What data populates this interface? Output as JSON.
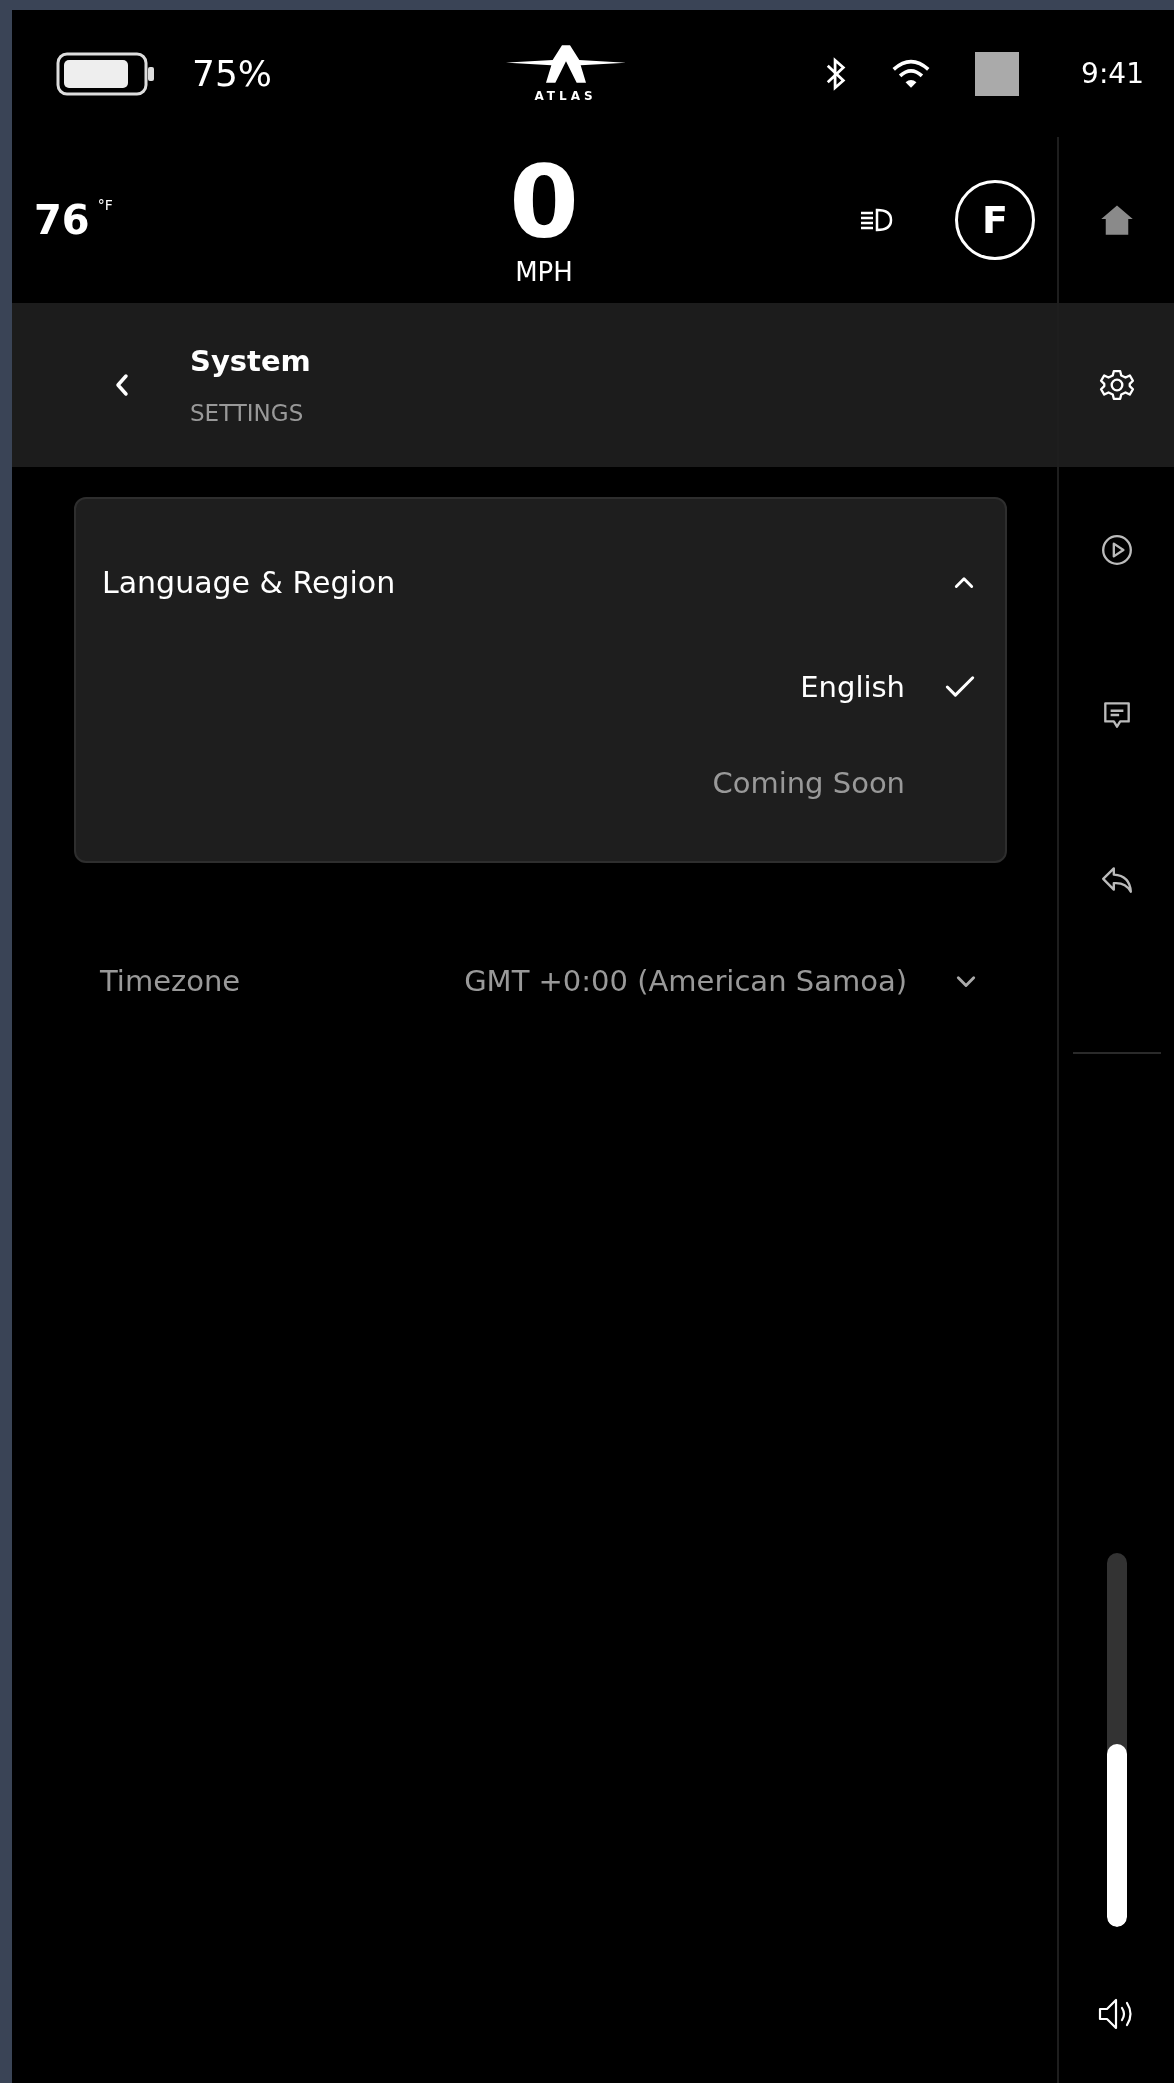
{
  "status_bar": {
    "battery": "75%",
    "logo": "ATLAS",
    "time": "9:41"
  },
  "drive_bar": {
    "temperature": "76",
    "temperature_unit": "°F",
    "speed": "0",
    "speed_unit": "MPH",
    "gear": "F"
  },
  "header": {
    "title": "System",
    "subtitle": "SETTINGS"
  },
  "sections": [
    {
      "title": "Language & Region",
      "expanded": true,
      "options": [
        {
          "label": "English",
          "selected": true,
          "disabled": false
        },
        {
          "label": "Coming Soon",
          "selected": false,
          "disabled": true
        }
      ]
    }
  ],
  "timezone": {
    "label": "Timezone",
    "value": "GMT +0:00 (American Samoa)",
    "expanded": false
  },
  "sidebar": {
    "items": [
      {
        "kind": "home",
        "selected": false
      },
      {
        "kind": "settings",
        "selected": true
      },
      {
        "kind": "media",
        "selected": false
      },
      {
        "kind": "messages",
        "selected": false
      },
      {
        "kind": "reply",
        "selected": false
      }
    ],
    "volume": {
      "level": 0.49
    }
  }
}
